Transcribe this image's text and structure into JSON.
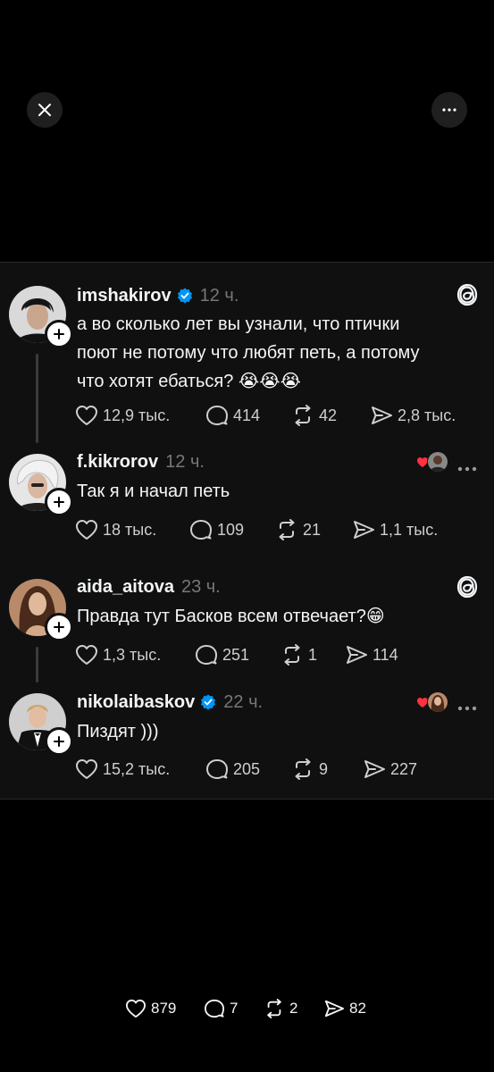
{
  "top": {
    "close_icon": "close-icon",
    "more_icon": "more-horizontal-icon"
  },
  "card1": {
    "post": {
      "username": "imshakirov",
      "verified": true,
      "time": "12 ч.",
      "text_lines": [
        "а во сколько лет вы узнали, что птички",
        "поют не потому что любят петь, а потому",
        "что хотят ебаться? 😭😭😭"
      ],
      "likes": "12,9 тыс.",
      "replies": "414",
      "reposts": "42",
      "shares": "2,8 тыс."
    },
    "reply": {
      "username": "f.kikrorov",
      "time": "12 ч.",
      "text": "Так я и начал петь",
      "likes": "18 тыс.",
      "replies": "109",
      "reposts": "21",
      "shares": "1,1 тыс."
    }
  },
  "card2": {
    "post": {
      "username": "aida_aitova",
      "time": "23 ч.",
      "text": "Правда тут Басков всем отвечает?😁",
      "likes": "1,3 тыс.",
      "replies": "251",
      "reposts": "1",
      "shares": "114"
    },
    "reply": {
      "username": "nikolaibaskov",
      "verified": true,
      "time": "22 ч.",
      "text": "Пиздят )))",
      "likes": "15,2 тыс.",
      "replies": "205",
      "reposts": "9",
      "shares": "227"
    }
  },
  "bottom": {
    "likes": "879",
    "replies": "7",
    "reposts": "2",
    "shares": "82"
  },
  "colors": {
    "background": "#000000",
    "card": "#101010",
    "verified": "#0095f6",
    "liked_heart": "#ff3040",
    "muted": "#777777"
  }
}
